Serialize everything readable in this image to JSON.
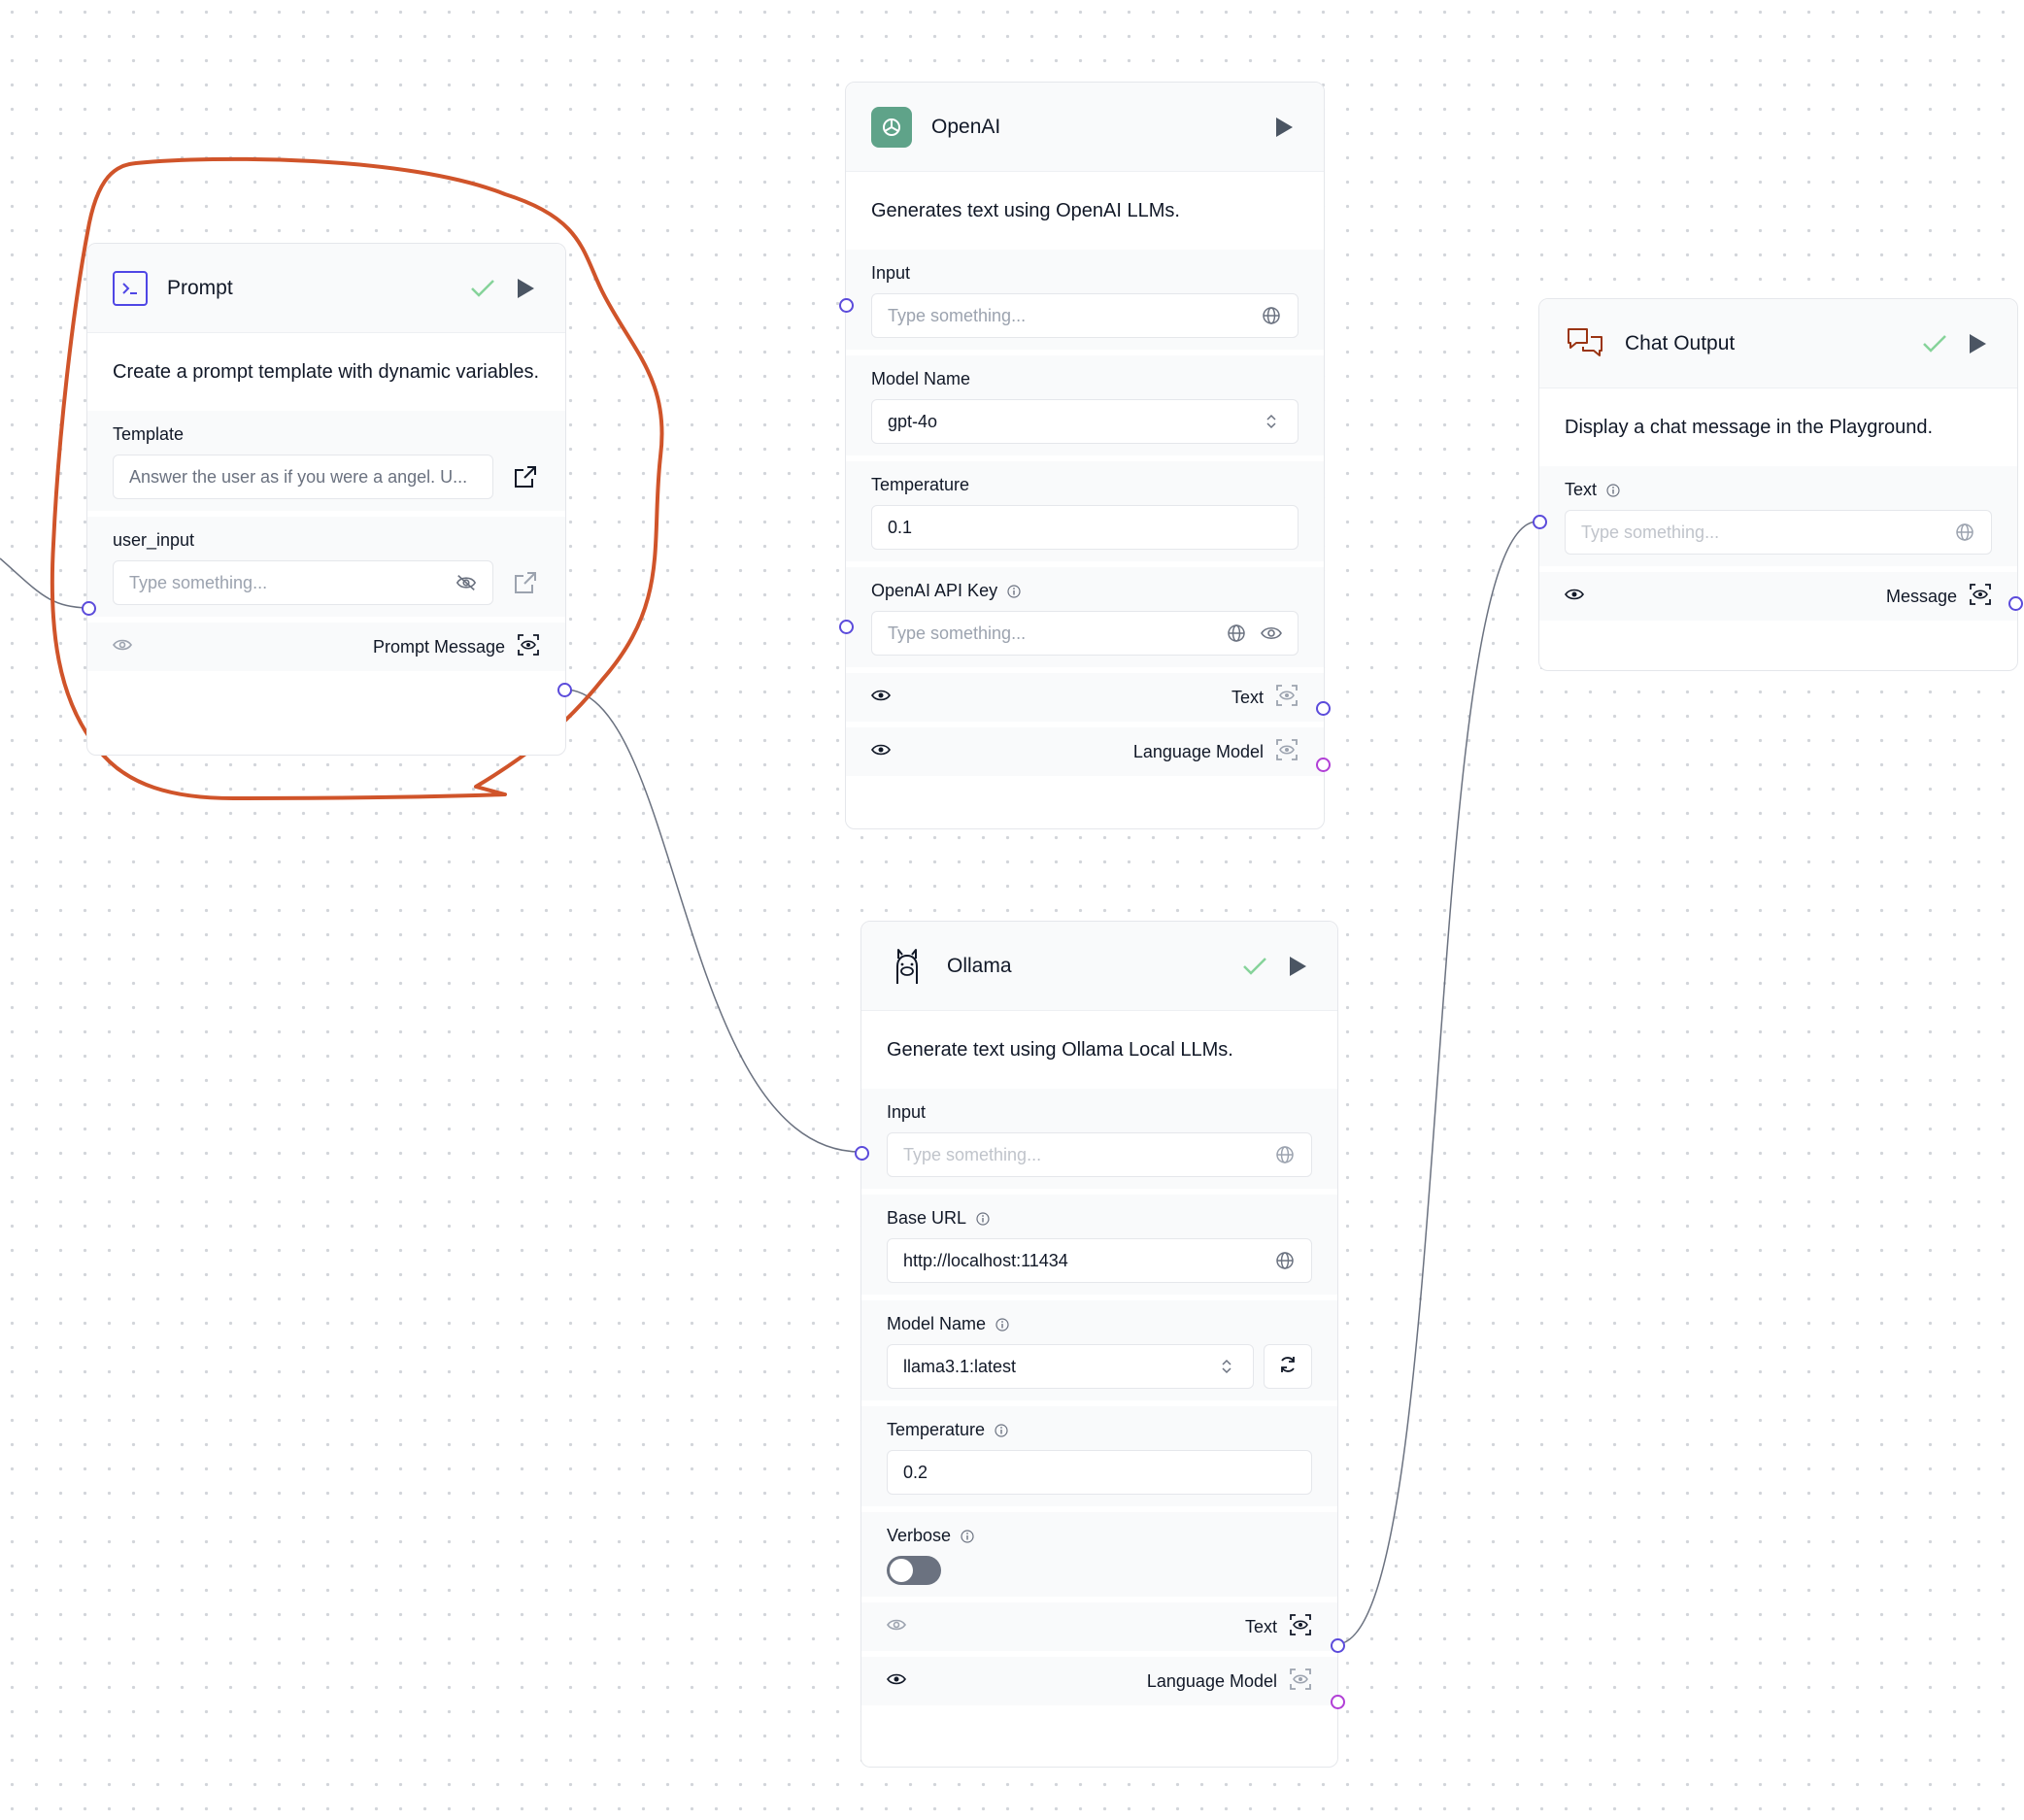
{
  "prompt": {
    "title": "Prompt",
    "description": "Create a prompt template with dynamic variables.",
    "template": {
      "label": "Template",
      "value": "Answer the user as if you were a angel. U..."
    },
    "user_input": {
      "label": "user_input",
      "placeholder": "Type something..."
    },
    "output_label": "Prompt Message"
  },
  "openai": {
    "title": "OpenAI",
    "description": "Generates text using OpenAI LLMs.",
    "input": {
      "label": "Input",
      "placeholder": "Type something..."
    },
    "model_name": {
      "label": "Model Name",
      "value": "gpt-4o"
    },
    "temperature": {
      "label": "Temperature",
      "value": "0.1"
    },
    "api_key": {
      "label": "OpenAI API Key",
      "placeholder": "Type something..."
    },
    "outputs": [
      "Text",
      "Language Model"
    ]
  },
  "chat_output": {
    "title": "Chat Output",
    "description": "Display a chat message in the Playground.",
    "text": {
      "label": "Text",
      "placeholder": "Type something..."
    },
    "output_label": "Message"
  },
  "ollama": {
    "title": "Ollama",
    "description": "Generate text using Ollama Local LLMs.",
    "input": {
      "label": "Input",
      "placeholder": "Type something..."
    },
    "base_url": {
      "label": "Base URL",
      "value": "http://localhost:11434"
    },
    "model_name": {
      "label": "Model Name",
      "value": "llama3.1:latest"
    },
    "temperature": {
      "label": "Temperature",
      "value": "0.2"
    },
    "verbose": {
      "label": "Verbose",
      "value": false
    },
    "outputs": [
      "Text",
      "Language Model"
    ]
  },
  "colors": {
    "handle": "#5b4bdb",
    "model_handle": "#b13fd6",
    "annotation": "#d0542a",
    "success_check": "#22c55e",
    "openai_icon_bg": "#5fa389"
  }
}
